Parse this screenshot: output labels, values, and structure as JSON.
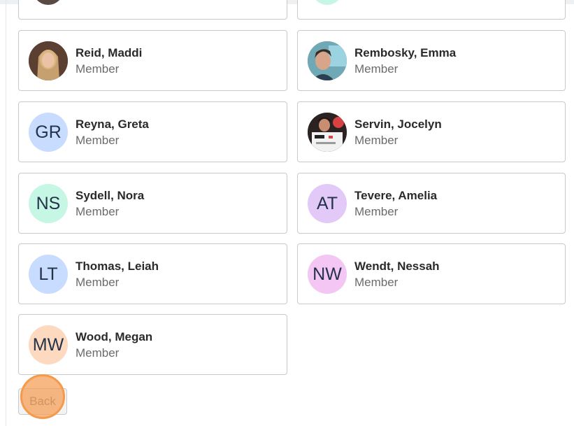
{
  "members": [
    {
      "name": "Reid, Maddi",
      "role": "Member",
      "initials": "",
      "avatar": "photo",
      "avatar_color": "#6b4a3a"
    },
    {
      "name": "Rembosky, Emma",
      "role": "Member",
      "initials": "",
      "avatar": "photo",
      "avatar_color": "#4d7f8a"
    },
    {
      "name": "Reyna, Greta",
      "role": "Member",
      "initials": "GR",
      "avatar": "initials",
      "avatar_color": "#c7dcff"
    },
    {
      "name": "Servin, Jocelyn",
      "role": "Member",
      "initials": "",
      "avatar": "photo",
      "avatar_color": "#3a2a2a"
    },
    {
      "name": "Sydell, Nora",
      "role": "Member",
      "initials": "NS",
      "avatar": "initials",
      "avatar_color": "#c6f6e4"
    },
    {
      "name": "Tevere, Amelia",
      "role": "Member",
      "initials": "AT",
      "avatar": "initials",
      "avatar_color": "#e2c9f7"
    },
    {
      "name": "Thomas, Leiah",
      "role": "Member",
      "initials": "LT",
      "avatar": "initials",
      "avatar_color": "#c7dcff"
    },
    {
      "name": "Wendt, Nessah",
      "role": "Member",
      "initials": "NW",
      "avatar": "initials",
      "avatar_color": "#f3c6f4"
    },
    {
      "name": "Wood, Megan",
      "role": "Member",
      "initials": "MW",
      "avatar": "initials",
      "avatar_color": "#fcd9bf"
    }
  ],
  "back_button": {
    "label": "Back"
  },
  "colors": {
    "highlight": "#f59a4b",
    "border": "#c9c9c9"
  }
}
